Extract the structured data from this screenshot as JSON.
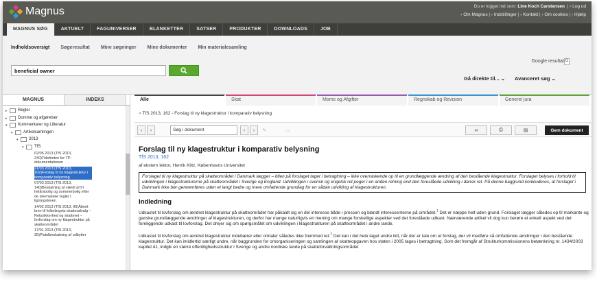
{
  "brand": {
    "name": "Magnus",
    "logo_colors": [
      "#e0407a",
      "#f0a030",
      "#5aa82e",
      "#2f9ad8"
    ]
  },
  "header": {
    "login_prefix": "Du er logget ind som:",
    "user": "Line Koch Carstensen",
    "logout": "Log ud",
    "links": [
      "Om Magnus",
      "Indstillinger",
      "Kontakt",
      "Om cookies",
      "Hjælp"
    ]
  },
  "mainnav": [
    "MAGNUS SØG",
    "AKTUELT",
    "FAGUNIVERSER",
    "BLANKETTER",
    "SATSER",
    "PRODUKTER",
    "DOWNLOADS",
    "JOB"
  ],
  "subnav": [
    "Indholdsoversigt",
    "Søgeresultat",
    "Mine søgninger",
    "Mine dokumenter",
    "Min materialesamling"
  ],
  "search": {
    "value": "beneficial owner",
    "google_label": "Google resultat",
    "goto_label": "Gå direkte til...",
    "advanced_label": "Avanceret søg"
  },
  "lefttabs": [
    "MAGNUS",
    "INDEKS"
  ],
  "tree": {
    "regler": "Regler",
    "domme": "Domme og afgørelser",
    "kommentarer": "Kommentarer og Litteratur",
    "artikelsamlingen": "Artikelsamlingen",
    "year": "2013",
    "tfs": "TfS",
    "docs": [
      "02/05 2013 (TfS 2013, 240)Tidsfristen for TP-dokumentationen",
      "21/03 2013 (TfS 2013, 162)Forslag til ny klagestruktur i komparativ belysning",
      "07/03 2013 (TfS 2013, 140)Beskatning af værdi af fri helårsbolig og sommerbolig efter de skematiske regler i ligningsloven",
      "14/02 2013 (TfS 2013, 96)Åbent brev til folketingets skatteudvalg – Retssikkerhed og skatteret – lovforslag om ny klagestruktur på skatteområdet",
      "17/01 2013 (TfS 2013, 35)Pistolbeskatning af udbytter"
    ]
  },
  "cattabs": [
    {
      "label": "Alle",
      "color": "#444444"
    },
    {
      "label": "Skat",
      "color": "#e0407a"
    },
    {
      "label": "Moms og Afgifter",
      "color": "#9b59b6"
    },
    {
      "label": "Regnskab og Revision",
      "color": "#2f9ad8"
    },
    {
      "label": "Generel jura",
      "color": "#5aa82e"
    }
  ],
  "breadcrumb": "TfS 2013, 162 - Forslag til ny klagestruktur i komparativ belysning",
  "toolbar": {
    "doc_search_placeholder": "Søg i dokument",
    "save_label": "Gem dokument"
  },
  "article": {
    "title": "Forslag til ny klagestruktur i komparativ belysning",
    "ref": "TfS 2013, 162",
    "author": "af ekstern lektor, Henrik Klitz, Københavns Universitet",
    "abstract": "Forslaget til ny klagestruktur på skatteområdet i Danmark lægger – titlen på forslaget taget i betragtning – ikke overraskende op til en grundlæggende ændring af den bestående klagestruktur. Forslaget belyses i forhold til udviklingen i klagestrukturerne på skatteområdet i Sverige og England. Udviklingen i svensk og engelsk ret peger i en anden retning end den foreslåede udvikling i dansk ret. På denne baggrund konkluderes, at forslaget i Danmark ikke bør gennemføres uden et langt bedre og mere omfattende grundlag for en sådan udvikling af klagestrukturen.",
    "section": "Indledning",
    "p1a": "Udkastet til lovforslag om ændret klagestruktur på skatteområdet har påkaldt sig en del interesse både i pressen og blandt interessenterne på området.",
    "p1_note": "1",
    "p1b": " Det er næppe helt uden grund. Forslaget lægger således op til markante og ganske grundlæggende ændringer af klagestrukturen, og derfor har mange naturligvis en mening om mange forskellige aspekter ved det foreslåede udkast. Nærværende artikel vil dog kun berøre et enkelt aspekt ved det foreliggende udkast til lovforslag. Det drejer sig om spørgsmålet om udviklingen i klagestrukturen på skatteområdet i andre lande.",
    "p2a": "Udkastet til lovforslag om ændret klagestruktur indebærer eller omtaler således ikke fremmed ret.",
    "p2_note": "2",
    "p2b": " Det kan i det hele taget undre lidt, når der er tale om et forslag, der vil medføre så omfattende ændringer i den bestående klagestruktur. Det kan imidlertid særligt undre, når baggrunden for omorganiseringen og samlingen af skatteopgaven hos staten i 2005 tages i betragtning. Som det fremgår af Strukturkommissionens betænkning nr. 1434/2003 kapitel 41, indgik en større offentlighedsstruktur i Sverige og andre nordiske lande på skatteforvaltningsområdet"
  }
}
